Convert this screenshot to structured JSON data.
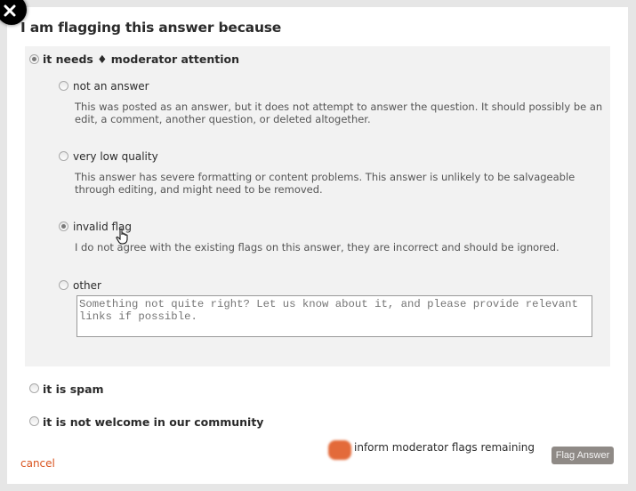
{
  "dialog": {
    "close_icon": "close-x-icon",
    "title": "I am flagging this answer because",
    "options": [
      {
        "label": "it needs ♦ moderator attention",
        "checked": true,
        "suboptions": [
          {
            "label": "not an answer",
            "checked": false,
            "description": "This was posted as an answer, but it does not attempt to answer the question. It should possibly be an edit, a comment, another question, or deleted altogether."
          },
          {
            "label": "very low quality",
            "checked": false,
            "description": "This answer has severe formatting or content problems. This answer is unlikely to be salvageable through editing, and might need to be removed."
          },
          {
            "label": "invalid flag",
            "checked": true,
            "description": "I do not agree with the existing flags on this answer, they are incorrect and should be ignored."
          },
          {
            "label": "other",
            "checked": false,
            "placeholder": "Something not quite right? Let us know about it, and please provide relevant links if possible."
          }
        ]
      },
      {
        "label": "it is spam",
        "checked": false
      },
      {
        "label": "it is not welcome in our community",
        "checked": false
      }
    ],
    "footer": {
      "cancel_label": "cancel",
      "flags_remaining_text": "inform moderator flags remaining",
      "flag_button_label": "Flag Answer"
    }
  },
  "colors": {
    "accent_link": "#d9531e",
    "panel_bg": "#f2f2f2",
    "button_bg": "#8f8a86"
  }
}
